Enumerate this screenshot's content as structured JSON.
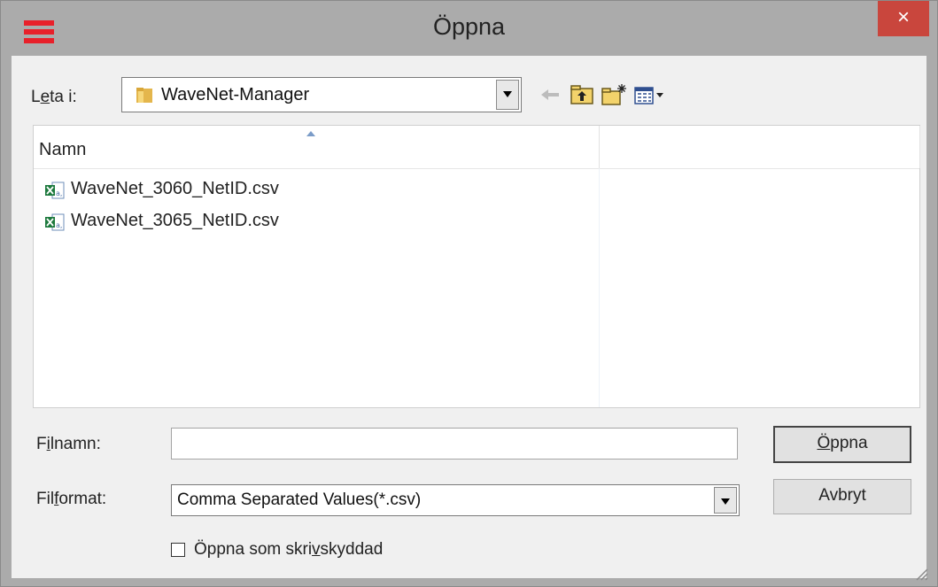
{
  "window": {
    "title": "Öppna",
    "close_label": "×"
  },
  "toolbar": {
    "look_in_label": "Leta i:",
    "look_in_accesskey_prefix": "L",
    "look_in_accesskey": "e",
    "look_in_rest": "ta i:",
    "look_in_value": "WaveNet-Manager",
    "icons": [
      "back-arrow-icon",
      "up-folder-icon",
      "new-folder-icon",
      "view-menu-icon"
    ]
  },
  "list": {
    "column_name": "Namn",
    "files": [
      {
        "name": "WaveNet_3060_NetID.csv",
        "icon": "csv-file-icon"
      },
      {
        "name": "WaveNet_3065_NetID.csv",
        "icon": "csv-file-icon"
      }
    ]
  },
  "form": {
    "filename_label": "Filnamn:",
    "filename_pre": "F",
    "filename_key": "i",
    "filename_post": "lnamn:",
    "filename_value": "",
    "filetype_label": "Filformat:",
    "filetype_pre": "Fil",
    "filetype_key": "f",
    "filetype_post": "ormat:",
    "filetype_value": "Comma Separated Values(*.csv)",
    "readonly_label": "Öppna som skrivskyddad",
    "readonly_pre": "Öppna som skri",
    "readonly_key": "v",
    "readonly_post": "skyddad",
    "readonly_checked": false
  },
  "buttons": {
    "open_key": "Ö",
    "open_rest": "ppna",
    "cancel": "Avbryt"
  },
  "colors": {
    "close": "#c9463d",
    "title_bar": "#ababab",
    "dialog_bg": "#f0f0f0",
    "app_icon": "#e8202a"
  }
}
